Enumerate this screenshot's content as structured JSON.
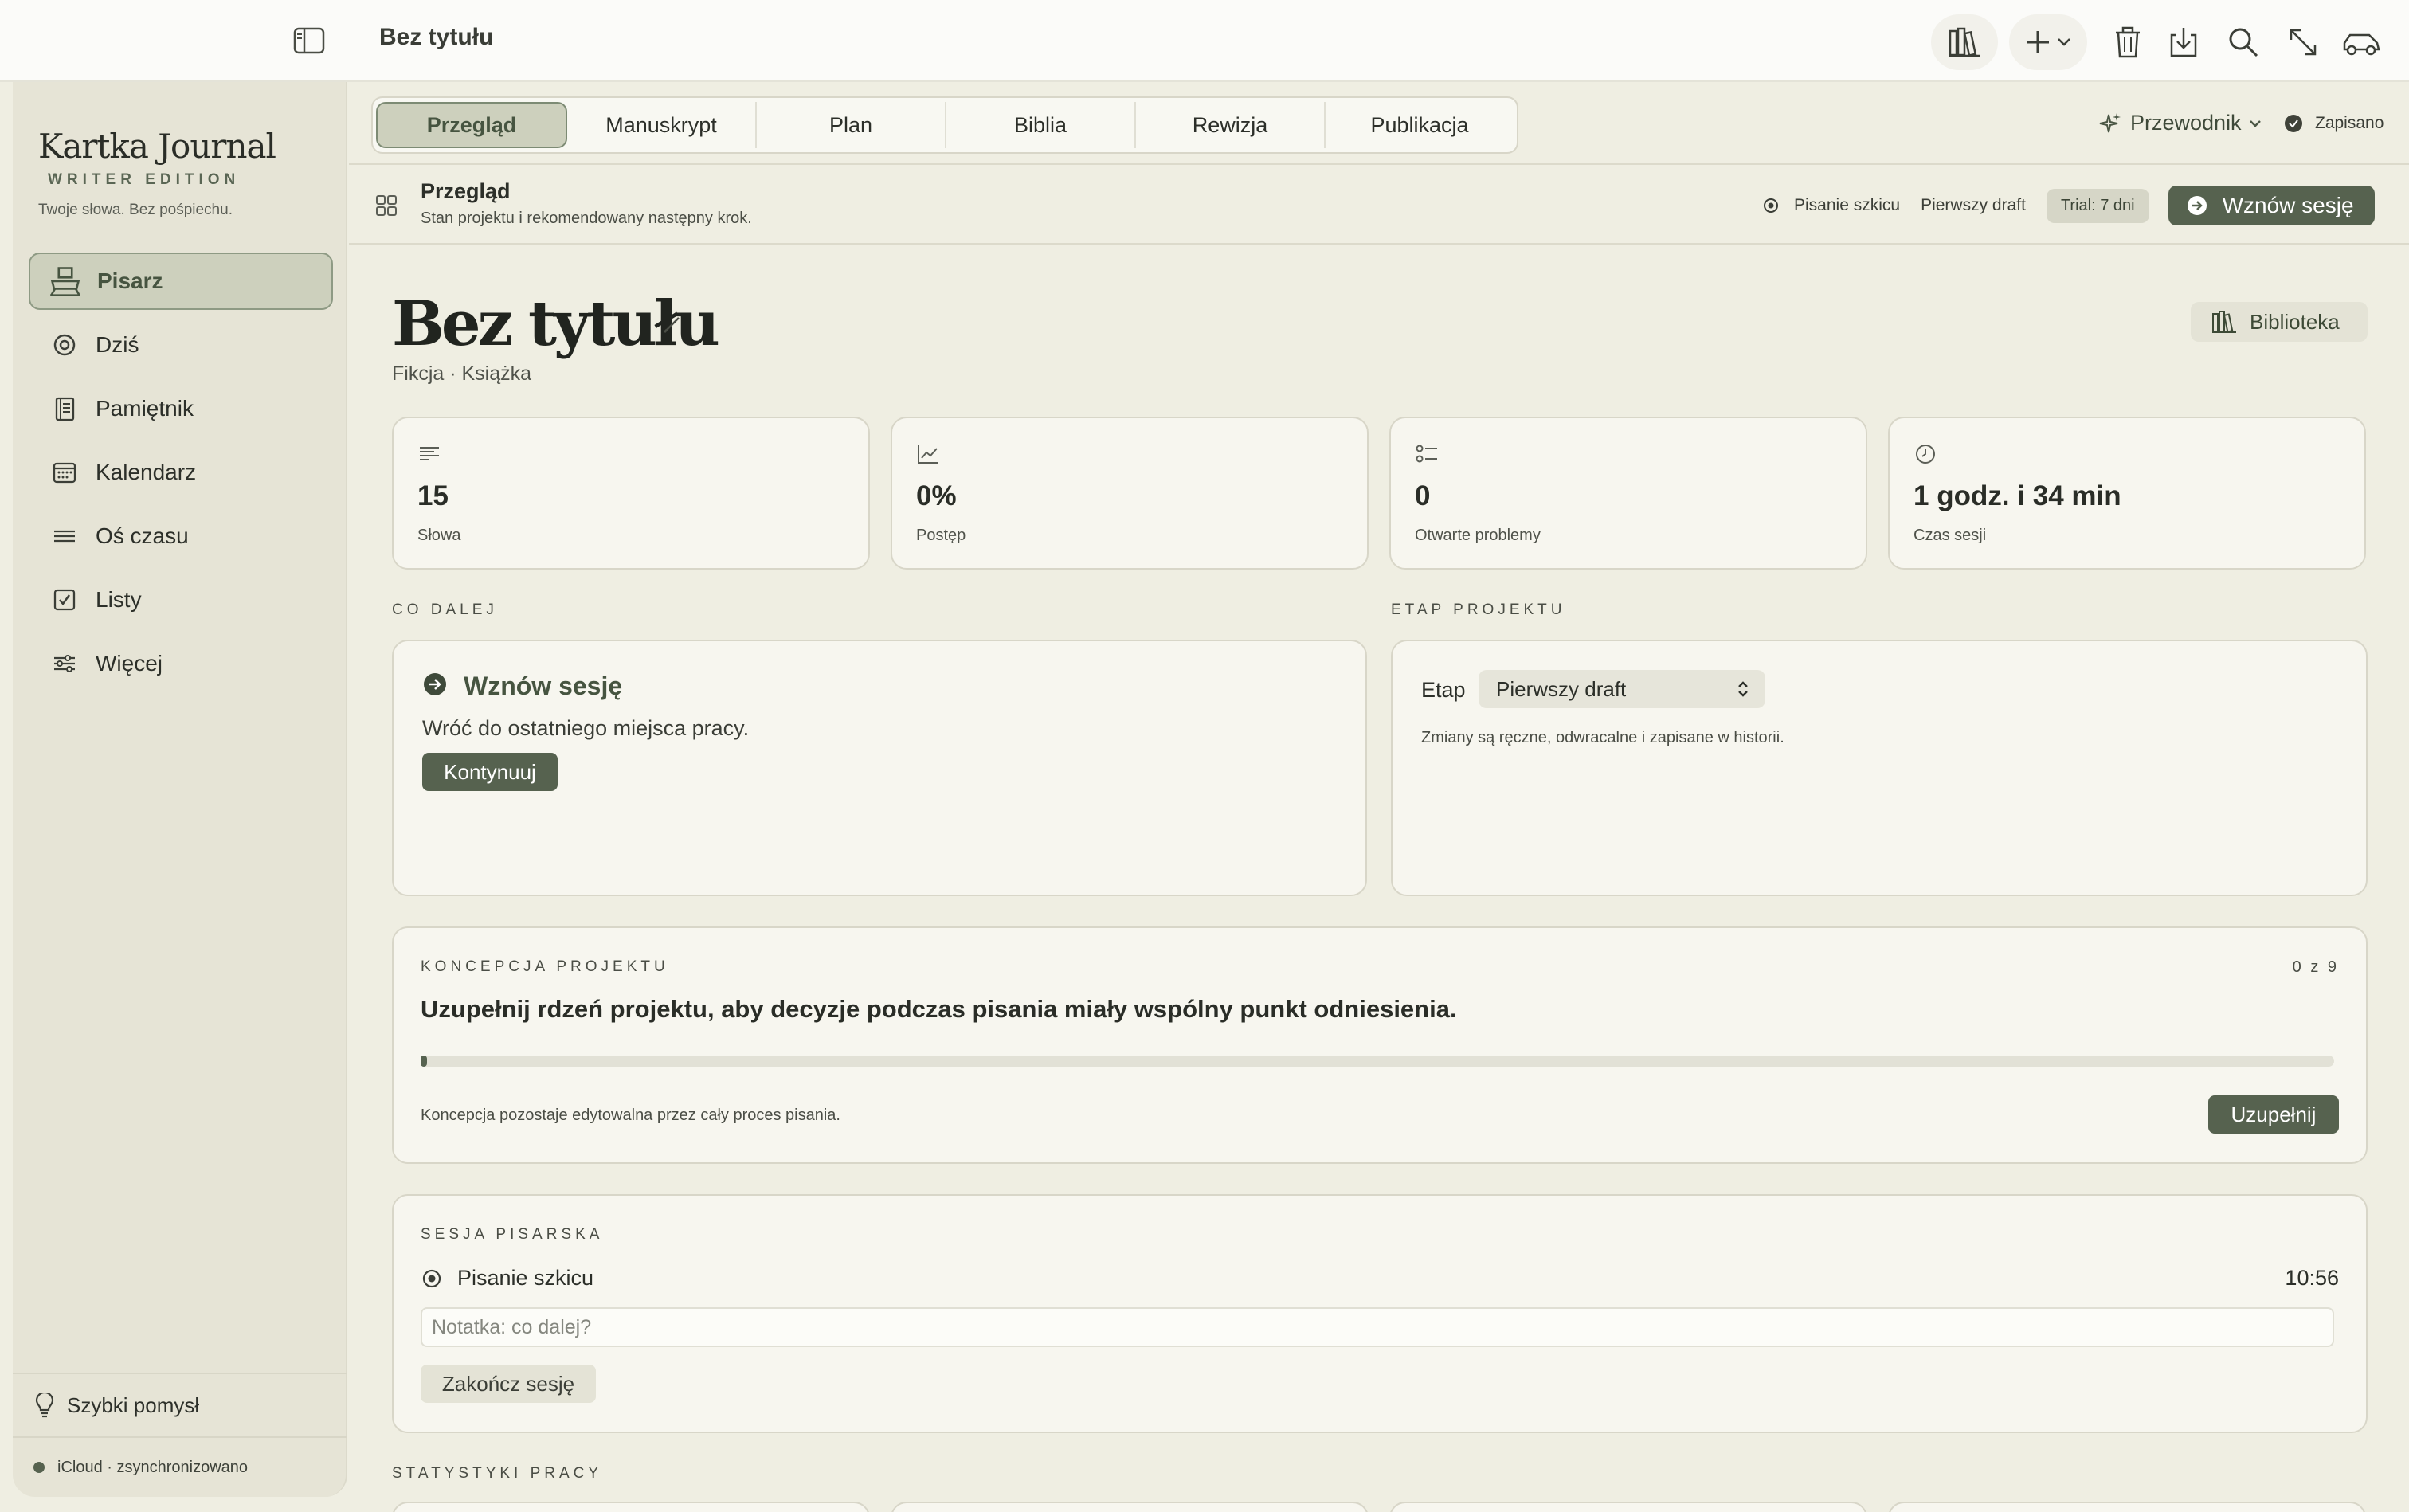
{
  "window": {
    "title": "Bez tytułu"
  },
  "sidebar": {
    "brand": "Kartka Journal",
    "edition": "WRITER EDITION",
    "tagline": "Twoje słowa. Bez pośpiechu.",
    "items": [
      {
        "label": "Pisarz",
        "icon": "typewriter-icon"
      },
      {
        "label": "Dziś",
        "icon": "target-icon"
      },
      {
        "label": "Pamiętnik",
        "icon": "notebook-icon"
      },
      {
        "label": "Kalendarz",
        "icon": "calendar-icon"
      },
      {
        "label": "Oś czasu",
        "icon": "timeline-icon"
      },
      {
        "label": "Listy",
        "icon": "checkbox-icon"
      },
      {
        "label": "Więcej",
        "icon": "sliders-icon"
      }
    ],
    "quick_idea": "Szybki pomysł",
    "sync_status": "iCloud · zsynchronizowano"
  },
  "tabs": [
    "Przegląd",
    "Manuskrypt",
    "Plan",
    "Biblia",
    "Rewizja",
    "Publikacja"
  ],
  "guide": "Przewodnik",
  "saved": "Zapisano",
  "subheader": {
    "title": "Przegląd",
    "subtitle": "Stan projektu i rekomendowany następny krok.",
    "mode": "Pisanie szkicu",
    "stage": "Pierwszy draft",
    "trial": "Trial: 7 dni",
    "resume": "Wznów sesję"
  },
  "project": {
    "title": "Bez tytułu",
    "subtitle": "Fikcja · Książka",
    "library": "Biblioteka"
  },
  "stats": [
    {
      "value": "15",
      "label": "Słowa"
    },
    {
      "value": "0%",
      "label": "Postęp"
    },
    {
      "value": "0",
      "label": "Otwarte problemy"
    },
    {
      "value": "1 godz. i 34 min",
      "label": "Czas sesji"
    }
  ],
  "next": {
    "heading": "CO DALEJ",
    "title": "Wznów sesję",
    "text": "Wróć do ostatniego miejsca pracy.",
    "button": "Kontynuuj"
  },
  "stage_card": {
    "heading": "ETAP PROJEKTU",
    "label": "Etap",
    "value": "Pierwszy draft",
    "note": "Zmiany są ręczne, odwracalne i zapisane w historii."
  },
  "concept": {
    "heading": "KONCEPCJA PROJEKTU",
    "count": "0 z 9",
    "title": "Uzupełnij rdzeń projektu, aby decyzje podczas pisania miały wspólny punkt odniesienia.",
    "progress": 0.0,
    "footer": "Koncepcja pozostaje edytowalna przez cały proces pisania.",
    "button": "Uzupełnij"
  },
  "session": {
    "heading": "SESJA PISARSKA",
    "mode": "Pisanie szkicu",
    "time": "10:56",
    "note_placeholder": "Notatka: co dalej?",
    "end": "Zakończ sesję"
  },
  "work_stats": {
    "heading": "STATYSTYKI PRACY"
  },
  "accent": "#56624f"
}
